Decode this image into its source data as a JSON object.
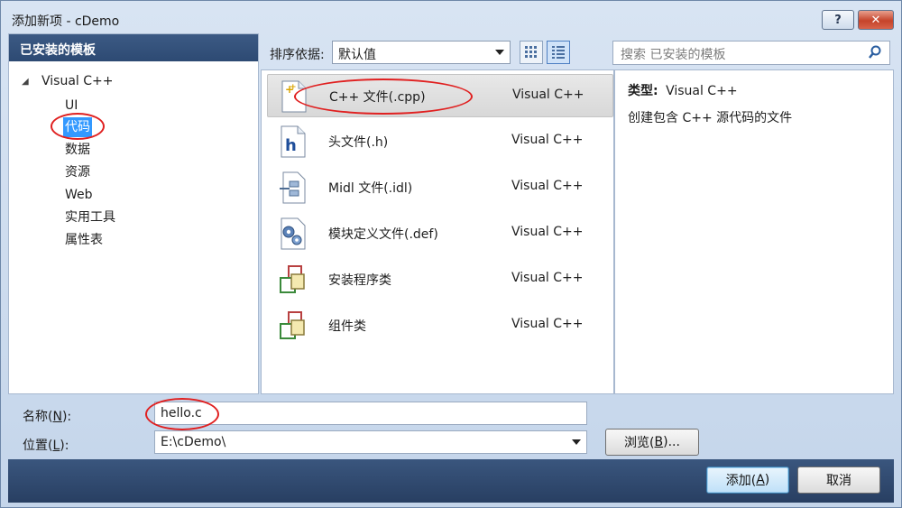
{
  "window": {
    "title": "添加新项 - cDemo",
    "help_label": "?",
    "close_label": "✕"
  },
  "left": {
    "header": "已安装的模板",
    "root": "Visual C++",
    "items": [
      "UI",
      "代码",
      "数据",
      "资源",
      "Web",
      "实用工具",
      "属性表"
    ],
    "selected_index": 1
  },
  "toolbar": {
    "sort_label": "排序依据:",
    "sort_value": "默认值",
    "search_placeholder": "搜索 已安装的模板"
  },
  "templates": [
    {
      "name": "C++ 文件(.cpp)",
      "lang": "Visual C++",
      "icon": "cpp-file-icon"
    },
    {
      "name": "头文件(.h)",
      "lang": "Visual C++",
      "icon": "header-file-icon"
    },
    {
      "name": "Midl 文件(.idl)",
      "lang": "Visual C++",
      "icon": "midl-file-icon"
    },
    {
      "name": "模块定义文件(.def)",
      "lang": "Visual C++",
      "icon": "def-file-icon"
    },
    {
      "name": "安装程序类",
      "lang": "Visual C++",
      "icon": "installer-class-icon"
    },
    {
      "name": "组件类",
      "lang": "Visual C++",
      "icon": "component-class-icon"
    }
  ],
  "info": {
    "type_label": "类型:",
    "type_value": "Visual C++",
    "description": "创建包含 C++ 源代码的文件"
  },
  "form": {
    "name_label_prefix": "名称(",
    "name_label_key": "N",
    "name_label_suffix": "):",
    "name_value": "hello.c",
    "location_label_prefix": "位置(",
    "location_label_key": "L",
    "location_label_suffix": "):",
    "location_value": "E:\\cDemo\\",
    "browse_prefix": "浏览(",
    "browse_key": "B",
    "browse_suffix": ")..."
  },
  "buttons": {
    "add_prefix": "添加(",
    "add_key": "A",
    "add_suffix": ")",
    "cancel": "取消"
  },
  "colors": {
    "header_bg": "#2d4a73",
    "selection": "#3399ff",
    "annotation": "#e02020"
  }
}
